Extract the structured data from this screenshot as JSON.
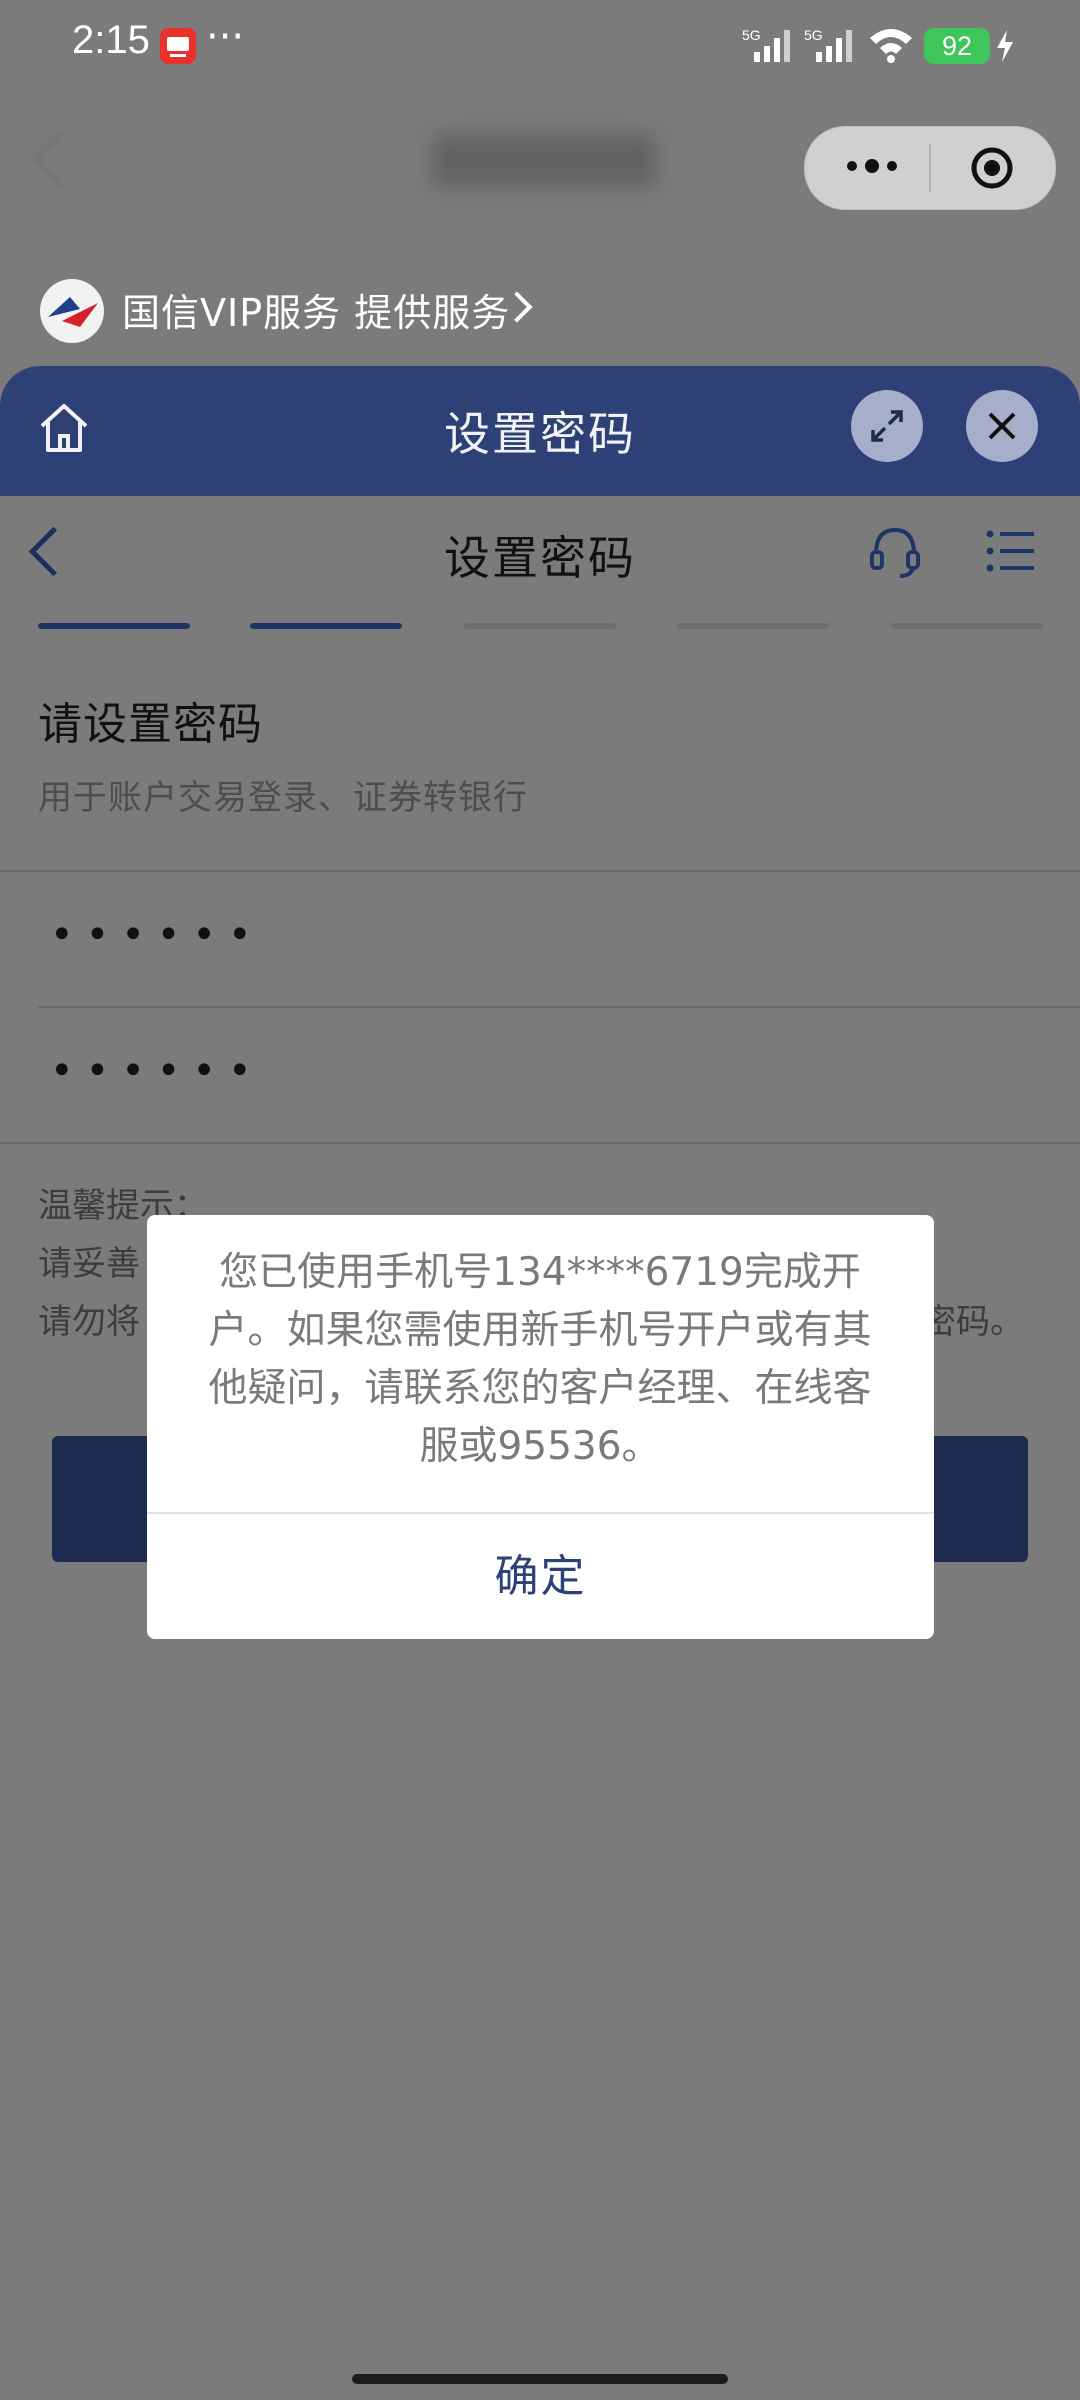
{
  "status_bar": {
    "time": "2:15",
    "notif_more": "···",
    "signal_1": "5G",
    "signal_2": "5G",
    "battery": "92",
    "icons": [
      "app-notification-icon",
      "signal-icon",
      "wifi-icon",
      "battery-icon",
      "charging-bolt-icon"
    ]
  },
  "mini_program_nav": {
    "capsule_icons": [
      "more-dots-icon",
      "close-target-icon"
    ]
  },
  "provider": {
    "text": "国信VIP服务 提供服务",
    "icon": "chevron-right-icon"
  },
  "sheet_header": {
    "title": "设置密码",
    "icons": [
      "home-icon",
      "expand-icon",
      "close-icon"
    ],
    "color": "#2d4177"
  },
  "page": {
    "title": "设置密码",
    "icons": [
      "back-icon",
      "headset-icon",
      "menu-icon"
    ],
    "steps": [
      {
        "state": "active"
      },
      {
        "state": "active"
      },
      {
        "state": "idle"
      },
      {
        "state": "idle"
      },
      {
        "state": "idle"
      }
    ],
    "section_title": "请设置密码",
    "section_subtitle": "用于账户交易登录、证券转银行",
    "password_1": "••••••",
    "password_2": "••••••",
    "tips_heading": "温馨提示：",
    "tip_1_visible": "请妥善",
    "tip_2_visible": "请勿将",
    "tip_2_end": "密码。"
  },
  "dialog": {
    "message": "您已使用手机号134****6719完成开户。如果您需使用新手机号开户或有其他疑问，请联系您的客户经理、在线客服或95536。",
    "confirm": "确定",
    "accent": "#2d4177"
  }
}
